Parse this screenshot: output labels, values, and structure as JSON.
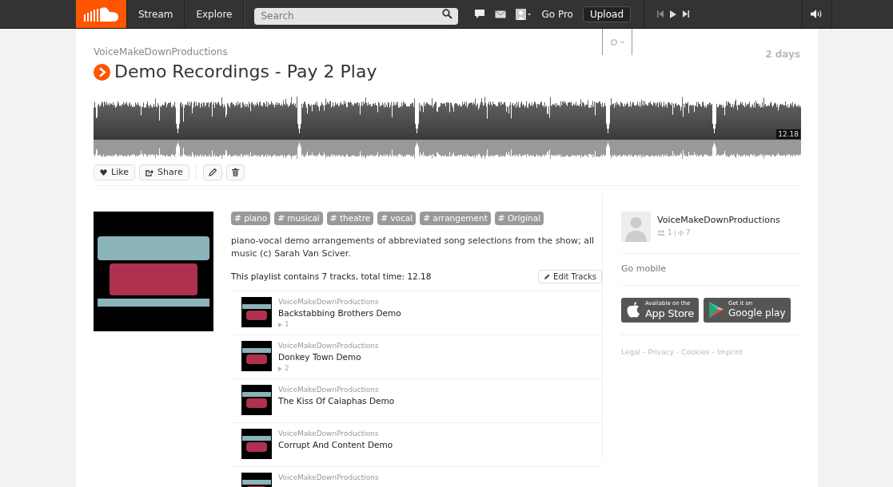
{
  "header": {
    "nav": [
      "Stream",
      "Explore"
    ],
    "search": {
      "placeholder": "Search"
    },
    "go_pro": "Go Pro",
    "upload": "Upload"
  },
  "playlist": {
    "user": "VoiceMakeDownProductions",
    "title": "Demo Recordings - Pay 2 Play",
    "age": "2 days",
    "duration": "12.18"
  },
  "actions": [
    {
      "kind": "like",
      "label": "Like"
    },
    {
      "kind": "share",
      "label": "Share"
    },
    {
      "kind": "edit"
    },
    {
      "kind": "delete"
    }
  ],
  "tags": [
    "# piano",
    "# musical",
    "# theatre",
    "# vocal",
    "# arrangement",
    "# Original"
  ],
  "description": "piano-vocal demo arrangements of abbreviated song selections from the show; all music (c) Sarah Van Sciver.",
  "summary": "This playlist contains 7 tracks, total time: 12.18",
  "edit_tracks": "Edit Tracks",
  "tracks": [
    {
      "artist": "VoiceMakeDownProductions",
      "title": "Backstabbing Brothers Demo",
      "plays": "1"
    },
    {
      "artist": "VoiceMakeDownProductions",
      "title": "Donkey Town Demo",
      "plays": "2"
    },
    {
      "artist": "VoiceMakeDownProductions",
      "title": "The Kiss Of Caiaphas Demo"
    },
    {
      "artist": "VoiceMakeDownProductions",
      "title": "Corrupt And Content Demo"
    },
    {
      "artist": "VoiceMakeDownProductions"
    }
  ],
  "sidebar": {
    "user": "VoiceMakeDownProductions",
    "followers": "1",
    "tracks": "7",
    "go_mobile": "Go mobile",
    "badges": [
      {
        "kind": "apple",
        "small": "Available on the",
        "big": "App Store"
      },
      {
        "kind": "google",
        "small": "Get it on",
        "big": "Google play"
      }
    ],
    "footer_links": [
      "Legal",
      "Privacy",
      "Cookies",
      "Imprint"
    ],
    "separator": "-"
  }
}
